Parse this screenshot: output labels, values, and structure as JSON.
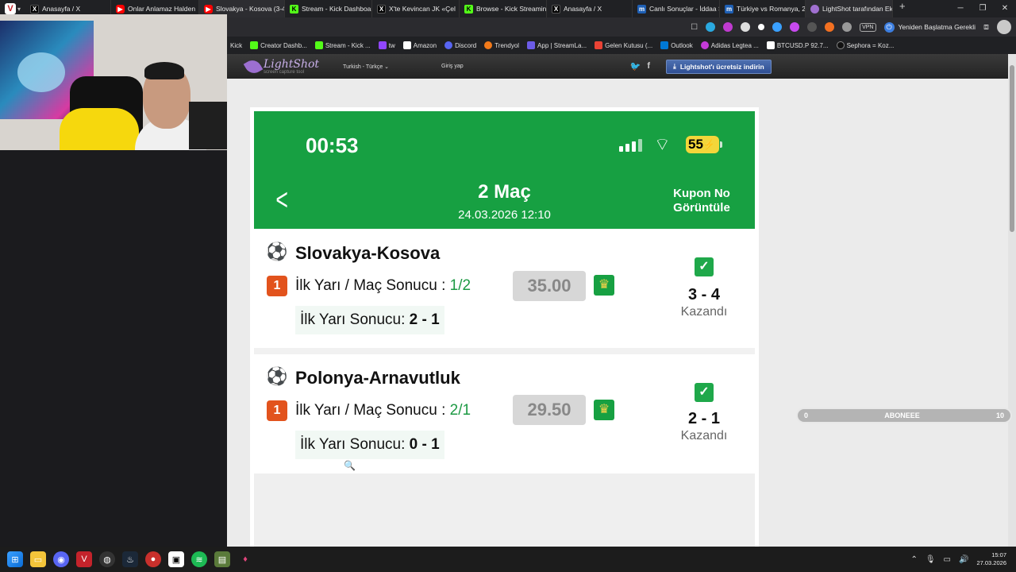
{
  "browser": {
    "tabs": [
      {
        "title": "Anasayfa / X",
        "icon": "x"
      },
      {
        "title": "Onlar Anlamaz Halden",
        "icon": "yt"
      },
      {
        "title": "Slovakya - Kosova (3-4)",
        "icon": "yt"
      },
      {
        "title": "Stream - Kick Dashboard",
        "icon": "kick"
      },
      {
        "title": "X'te Kevincan JK «Çel",
        "icon": "x"
      },
      {
        "title": "Browse - Kick Streaming",
        "icon": "kick"
      },
      {
        "title": "Anasayfa / X",
        "icon": "x"
      },
      {
        "title": "Canlı Sonuçlar - İddaa S",
        "icon": "m"
      },
      {
        "title": "Türkiye vs Romanya, 26.(",
        "icon": "m"
      },
      {
        "title": "LightShot tarafından Ek",
        "icon": "ls"
      }
    ],
    "new_tab": "+",
    "vpn_label": "VPN",
    "restart_label": "Yeniden Başlatma Gerekli",
    "bookmarks": [
      {
        "label": "Kick",
        "color": ""
      },
      {
        "label": "Creator Dashb...",
        "color": "#53fc18"
      },
      {
        "label": "Stream - Kick ...",
        "color": "#53fc18"
      },
      {
        "label": "tw",
        "color": "#9146ff"
      },
      {
        "label": "Amazon",
        "color": "#ffffff"
      },
      {
        "label": "Discord",
        "color": "#5865f2"
      },
      {
        "label": "Trendyol",
        "color": "#f27a1a"
      },
      {
        "label": "App | StreamLa...",
        "color": "#6c5ce7"
      },
      {
        "label": "Gelen Kutusu (...",
        "color": "#ea4335"
      },
      {
        "label": "Outlook",
        "color": "#0078d4"
      },
      {
        "label": "Adidas Legtea ...",
        "color": "#c43ad8"
      },
      {
        "label": "BTCUSD.P 92.7...",
        "color": "#ffffff"
      },
      {
        "label": "Sephora = Koz...",
        "color": "#111111"
      }
    ]
  },
  "lightshot": {
    "name": "LightShot",
    "subtitle": "screen capture tool",
    "language": "Turkish - Türkçe",
    "login": "Giriş yap",
    "download": "Lightshot'ı ücretsiz indirin"
  },
  "phone": {
    "time": "00:53",
    "battery": "55",
    "title": "2 Maç",
    "datetime": "24.03.2026 12:10",
    "kupon": "Kupon No Görüntüle",
    "matches": [
      {
        "name": "Slovakya-Kosova",
        "num": "1",
        "market": "İlk Yarı / Maç Sonucu :",
        "pick": "1/2",
        "odd": "35.00",
        "ht_label": "İlk Yarı Sonucu:",
        "ht_score": "2 - 1",
        "score": "3 - 4",
        "status": "Kazandı"
      },
      {
        "name": "Polonya-Arnavutluk",
        "num": "1",
        "market": "İlk Yarı / Maç Sonucu :",
        "pick": "2/1",
        "odd": "29.50",
        "ht_label": "İlk Yarı Sonucu:",
        "ht_score": "0 - 1",
        "score": "2 - 1",
        "status": "Kazandı"
      }
    ]
  },
  "overlay": {
    "left": "0",
    "label": "ABONEEE",
    "right": "10"
  },
  "taskbar": {
    "time": "15:07",
    "date": "27.03.2026"
  }
}
